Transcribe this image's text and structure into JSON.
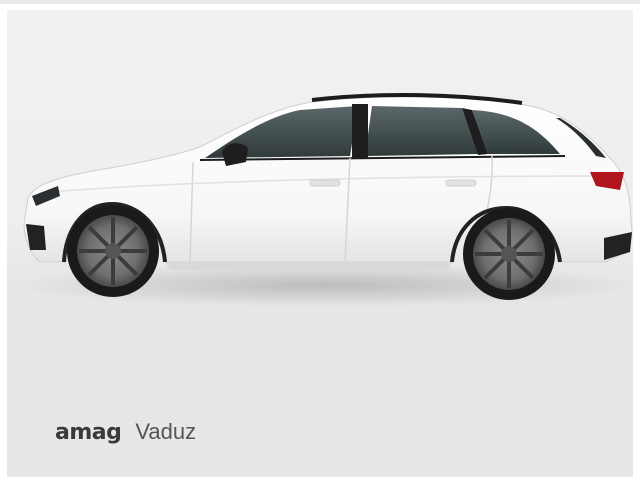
{
  "listing": {
    "image_alt": "vehicle-photo",
    "dealer": {
      "brand": "amag",
      "location": "Vaduz"
    }
  },
  "colors": {
    "body": "#ffffff",
    "background": "#eeeeee",
    "glass": "#3e4a4c",
    "trim": "#1c1c1c"
  }
}
